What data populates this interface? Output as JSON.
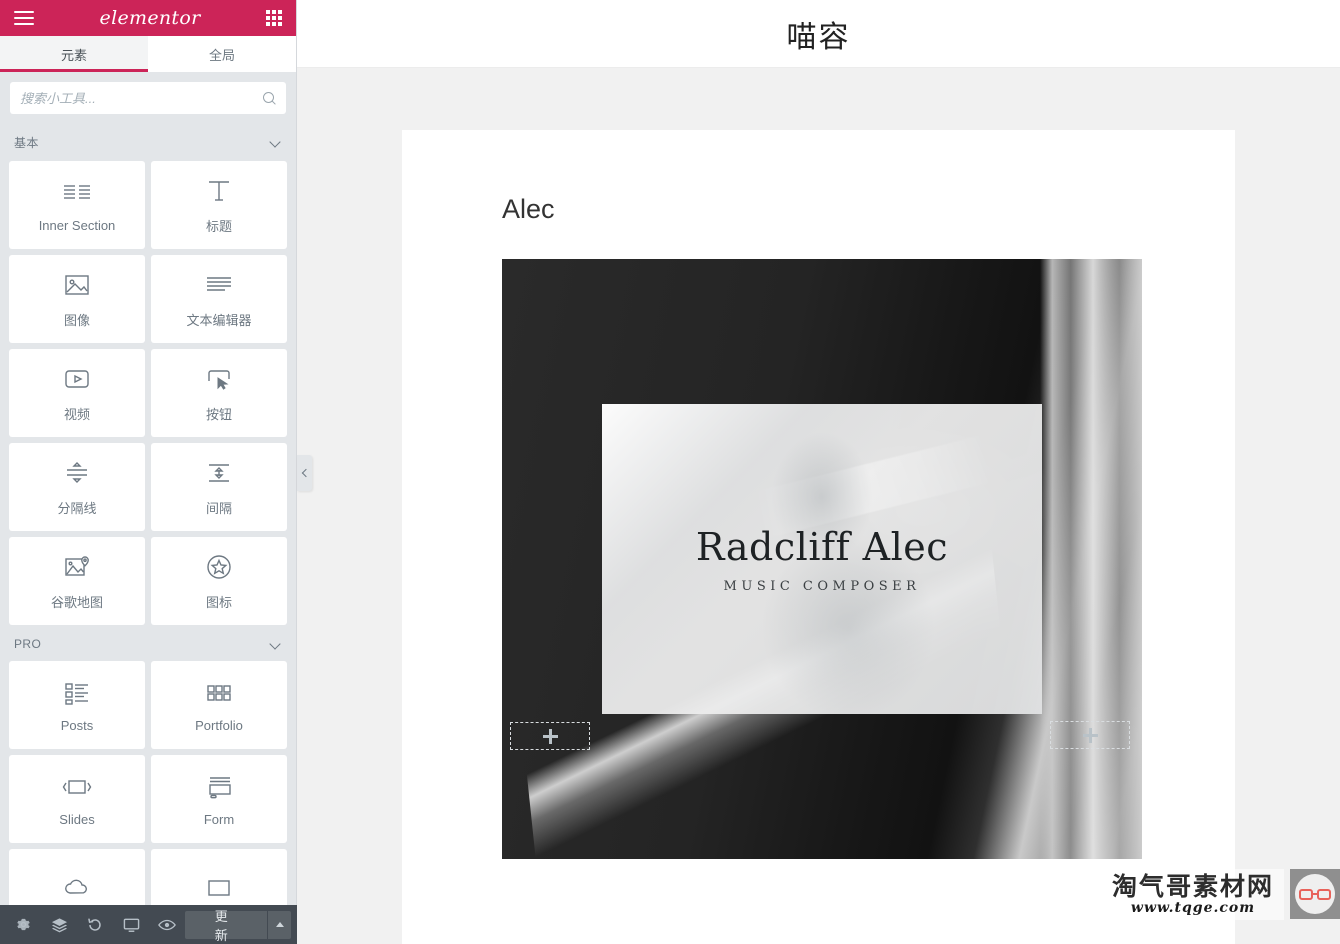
{
  "panel": {
    "brand": "elementor",
    "menu_icon": "hamburger-icon",
    "apps_icon": "grid-icon",
    "tabs": [
      {
        "label": "元素",
        "active": true
      },
      {
        "label": "全局",
        "active": false
      }
    ],
    "search": {
      "placeholder": "搜索小工具...",
      "value": "",
      "icon": "search-icon"
    },
    "sections": [
      {
        "title": "基本",
        "widgets": [
          {
            "label": "Inner Section",
            "icon": "inner-section-icon"
          },
          {
            "label": "标题",
            "icon": "heading-icon"
          },
          {
            "label": "图像",
            "icon": "image-icon"
          },
          {
            "label": "文本编辑器",
            "icon": "text-editor-icon"
          },
          {
            "label": "视频",
            "icon": "video-icon"
          },
          {
            "label": "按钮",
            "icon": "button-icon"
          },
          {
            "label": "分隔线",
            "icon": "divider-icon"
          },
          {
            "label": "间隔",
            "icon": "spacer-icon"
          },
          {
            "label": "谷歌地图",
            "icon": "google-maps-icon"
          },
          {
            "label": "图标",
            "icon": "star-icon"
          }
        ]
      },
      {
        "title": "PRO",
        "widgets": [
          {
            "label": "Posts",
            "icon": "posts-icon"
          },
          {
            "label": "Portfolio",
            "icon": "portfolio-icon"
          },
          {
            "label": "Slides",
            "icon": "slides-icon"
          },
          {
            "label": "Form",
            "icon": "form-icon"
          }
        ]
      }
    ],
    "collapse_handle": "chevron-left-icon"
  },
  "toolbar": {
    "buttons": [
      {
        "name": "settings",
        "icon": "gear-icon"
      },
      {
        "name": "navigator",
        "icon": "layers-icon"
      },
      {
        "name": "history",
        "icon": "history-icon"
      },
      {
        "name": "responsive",
        "icon": "monitor-icon"
      },
      {
        "name": "preview",
        "icon": "eye-icon"
      }
    ],
    "update_label": "更新",
    "caret_icon": "caret-up-icon"
  },
  "canvas": {
    "site_title": "喵容",
    "post_title": "Alec",
    "hero": {
      "name": "Radcliff Alec",
      "subtitle": "MUSIC COMPOSER"
    },
    "add_section_left": "+",
    "add_section_right": "+"
  },
  "watermark": {
    "cn": "淘气哥素材网",
    "url": "www.tqge.com",
    "logo": "glasses-icon"
  },
  "colors": {
    "brand": "#cc2458",
    "panel_bg": "#e3e6e9",
    "toolbar_bg": "#434a52",
    "canvas_bg": "#f1f1f1"
  }
}
